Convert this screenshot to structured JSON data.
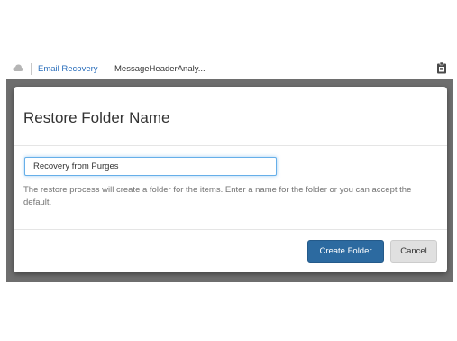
{
  "topbar": {
    "app_icon": "cloud-icon",
    "tabs": [
      {
        "label": "Email Recovery",
        "active": true
      },
      {
        "label": "MessageHeaderAnaly..."
      }
    ],
    "right_icon": "clipboard-icon"
  },
  "dialog": {
    "title": "Restore Folder Name",
    "folder_name_value": "Recovery from Purges",
    "help_text": "The restore process will create a folder for the items. Enter a name for the folder or you can accept the default.",
    "create_label": "Create Folder",
    "cancel_label": "Cancel"
  },
  "colors": {
    "accent": "#2c6aa0",
    "link": "#2a6ebb",
    "overlay": "#6e6e6e"
  }
}
